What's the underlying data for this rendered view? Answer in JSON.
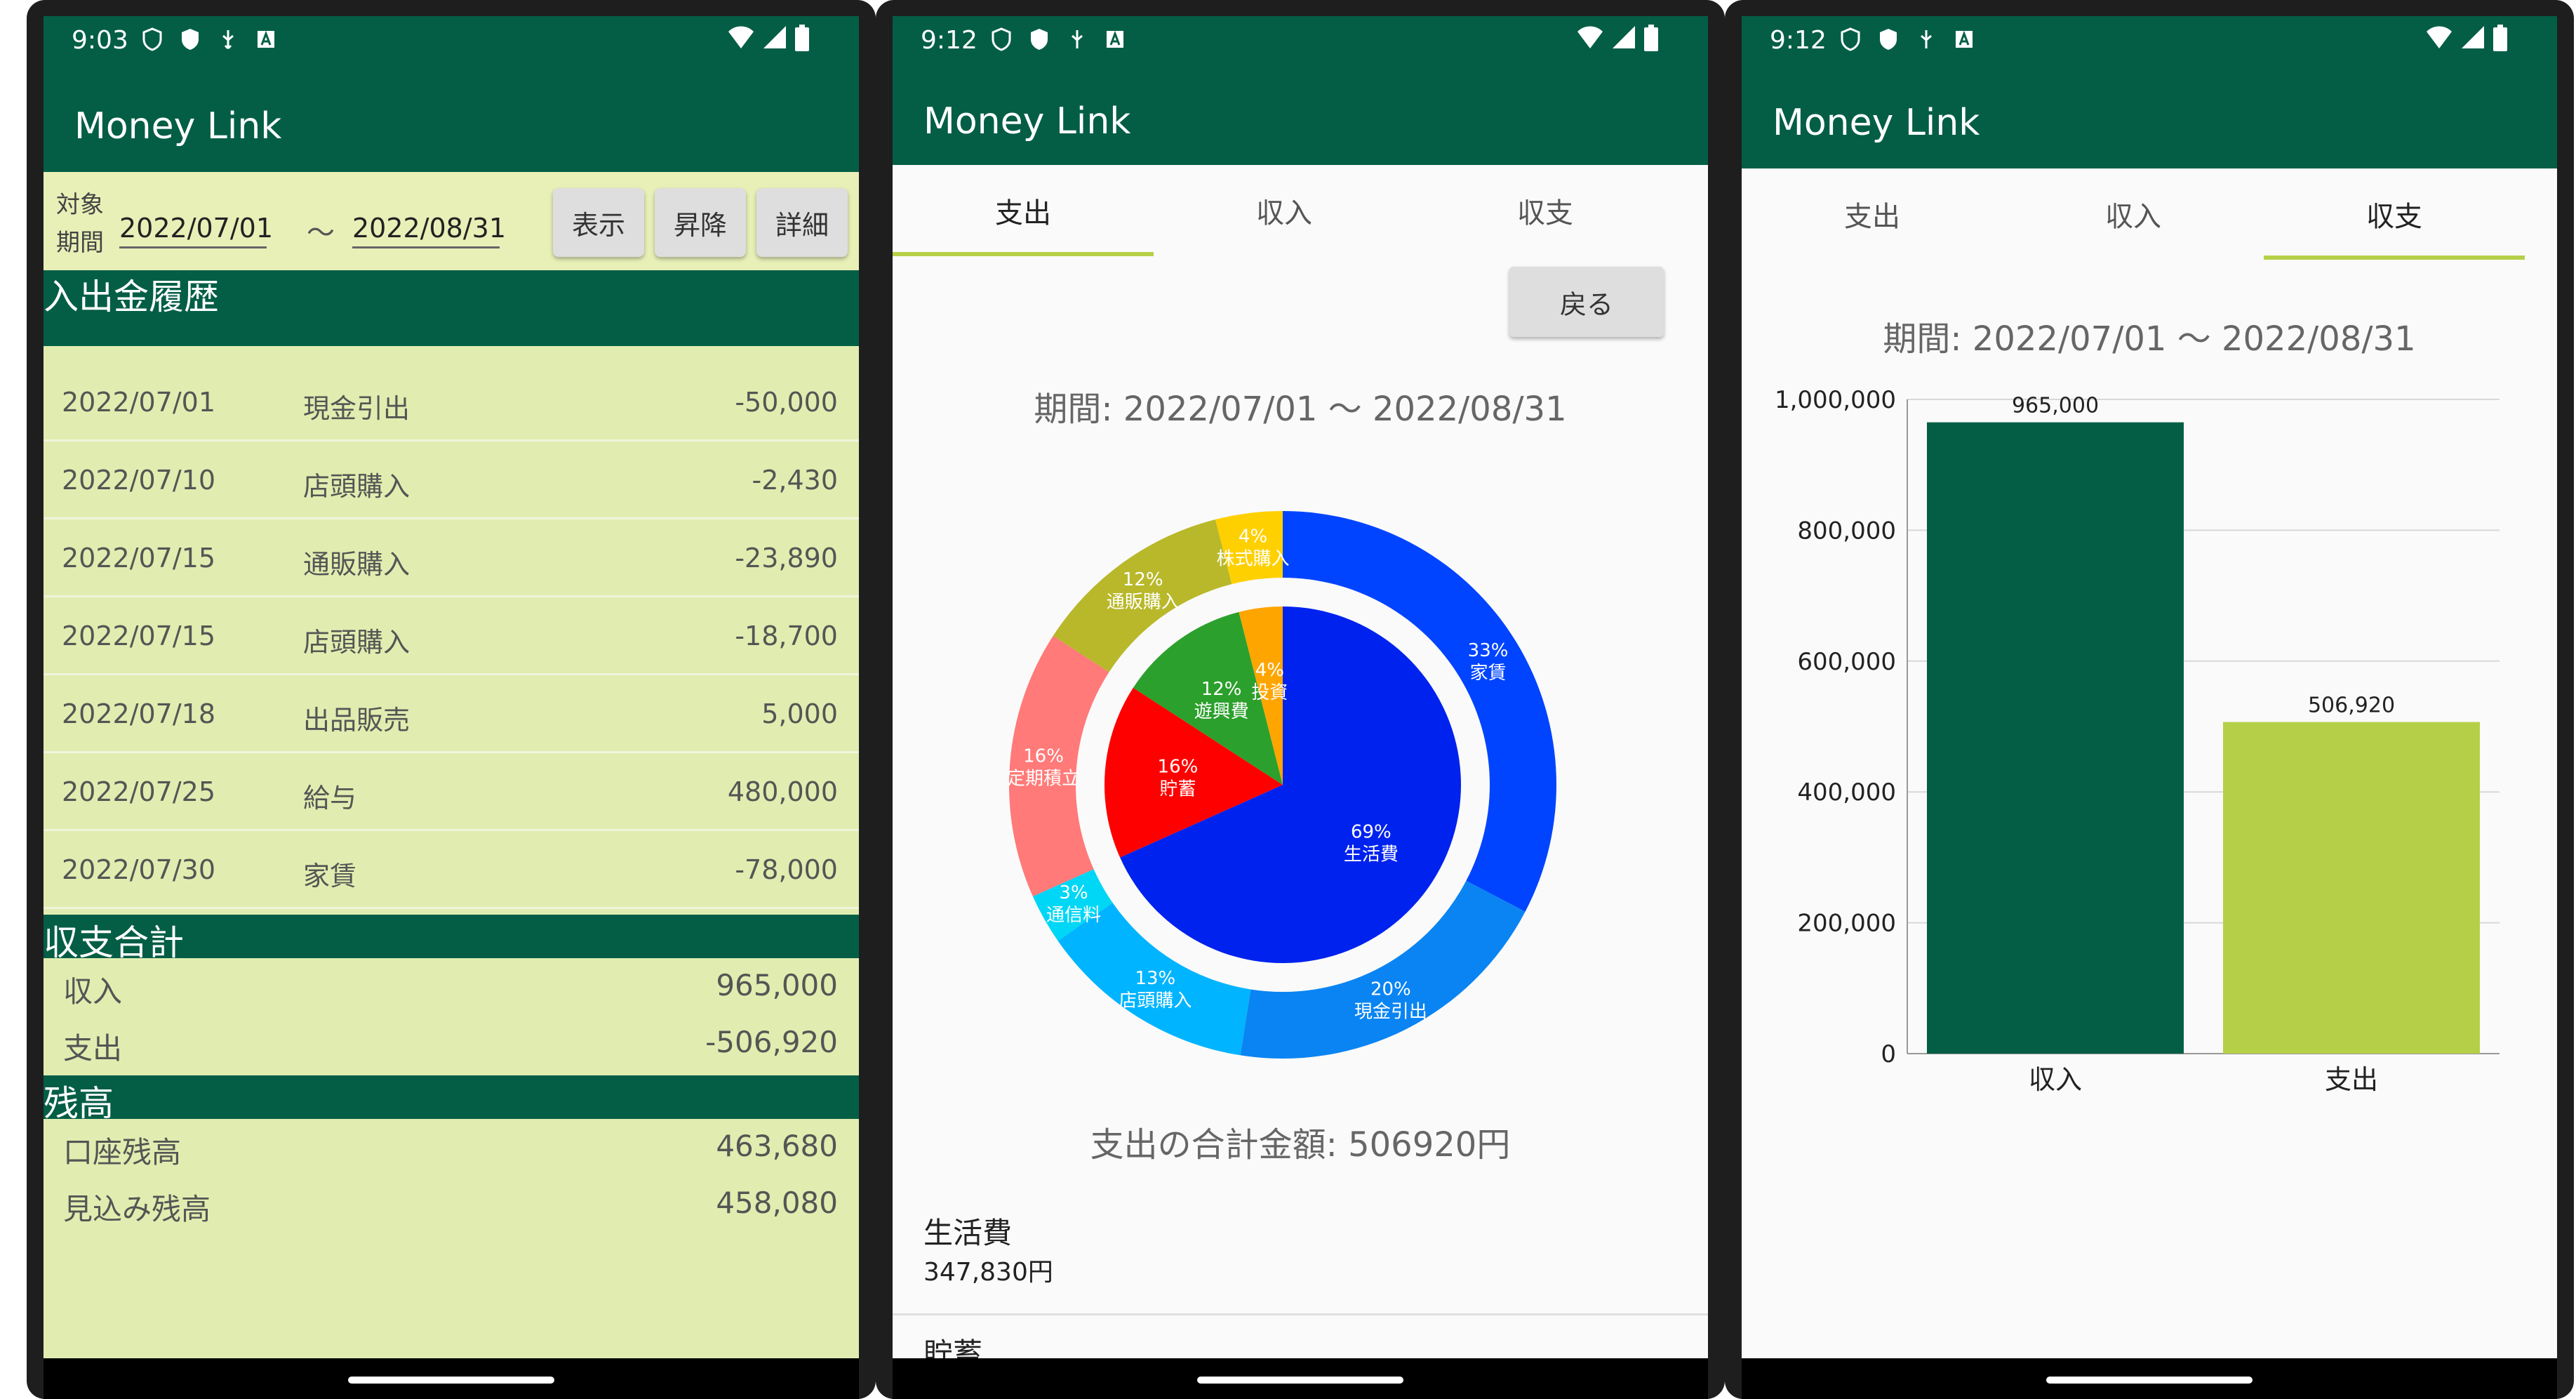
{
  "app_title": "Money Link",
  "screens": [
    {
      "time": "9:03",
      "filter": {
        "label": "対象\n期間",
        "from": "2022/07/01",
        "tilde": "〜",
        "to": "2022/08/31",
        "show_btn": "表示",
        "sort_btn": "昇降",
        "detail_btn": "詳細"
      },
      "history_title": "入出金履歴",
      "history": [
        {
          "date": "2022/07/01",
          "kind": "現金引出",
          "amount": "-50,000"
        },
        {
          "date": "2022/07/10",
          "kind": "店頭購入",
          "amount": "-2,430"
        },
        {
          "date": "2022/07/15",
          "kind": "通販購入",
          "amount": "-23,890"
        },
        {
          "date": "2022/07/15",
          "kind": "店頭購入",
          "amount": "-18,700"
        },
        {
          "date": "2022/07/18",
          "kind": "出品販売",
          "amount": "5,000"
        },
        {
          "date": "2022/07/25",
          "kind": "給与",
          "amount": "480,000"
        },
        {
          "date": "2022/07/30",
          "kind": "家賃",
          "amount": "-78,000"
        }
      ],
      "summary_title": "収支合計",
      "summary": [
        {
          "label": "収入",
          "value": "965,000"
        },
        {
          "label": "支出",
          "value": "-506,920"
        }
      ],
      "balance_title": "残高",
      "balance": [
        {
          "label": "口座残高",
          "value": "463,680"
        },
        {
          "label": "見込み残高",
          "value": "458,080"
        }
      ]
    },
    {
      "time": "9:12",
      "tabs": [
        "支出",
        "収入",
        "収支"
      ],
      "back_btn": "戻る",
      "period": "期間: 2022/07/01 〜 2022/08/31",
      "total": "支出の合計金額: 506920円",
      "items": [
        {
          "name": "生活費",
          "value": "347,830円"
        },
        {
          "name": "貯蓄"
        }
      ]
    },
    {
      "time": "9:12",
      "tabs": [
        "支出",
        "収入",
        "収支"
      ],
      "period": "期間: 2022/07/01 〜 2022/08/31"
    }
  ],
  "chart_data": [
    {
      "type": "pie",
      "rings": [
        {
          "name": "outer",
          "slices": [
            {
              "label": "家賃",
              "pct": 33,
              "text": "33%",
              "color": "#0044ff"
            },
            {
              "label": "現金引出",
              "pct": 20,
              "text": "20%",
              "color": "#0a84f2"
            },
            {
              "label": "店頭購入",
              "pct": 13,
              "text": "13%",
              "color": "#00b4ff"
            },
            {
              "label": "通信料",
              "pct": 3,
              "text": "3%",
              "color": "#00d6f5"
            },
            {
              "label": "定期積立",
              "pct": 16,
              "text": "16%",
              "color": "#ff7a78"
            },
            {
              "label": "通販購入",
              "pct": 12,
              "text": "12%",
              "color": "#b8b82a"
            },
            {
              "label": "株式購入",
              "pct": 4,
              "text": "4%",
              "color": "#ffd000"
            }
          ]
        },
        {
          "name": "inner",
          "slices": [
            {
              "label": "生活費",
              "pct": 69,
              "text": "69%",
              "color": "#0022ee"
            },
            {
              "label": "貯蓄",
              "pct": 16,
              "text": "16%",
              "color": "#ff0000"
            },
            {
              "label": "遊興費",
              "pct": 12,
              "text": "12%",
              "color": "#2ca02c"
            },
            {
              "label": "投資",
              "pct": 4,
              "text": "4%",
              "color": "#ffa500"
            }
          ]
        }
      ]
    },
    {
      "type": "bar",
      "categories": [
        "収入",
        "支出"
      ],
      "values": [
        965000,
        506920
      ],
      "value_labels": [
        "965,000",
        "506,920"
      ],
      "colors": [
        "#045e46",
        "#b5d048"
      ],
      "ylim": [
        0,
        1000000
      ],
      "yticks": [
        0,
        200000,
        400000,
        600000,
        800000,
        1000000
      ],
      "ytick_labels": [
        "0",
        "200,000",
        "400,000",
        "600,000",
        "800,000",
        "1,000,000"
      ],
      "grid": true
    }
  ]
}
